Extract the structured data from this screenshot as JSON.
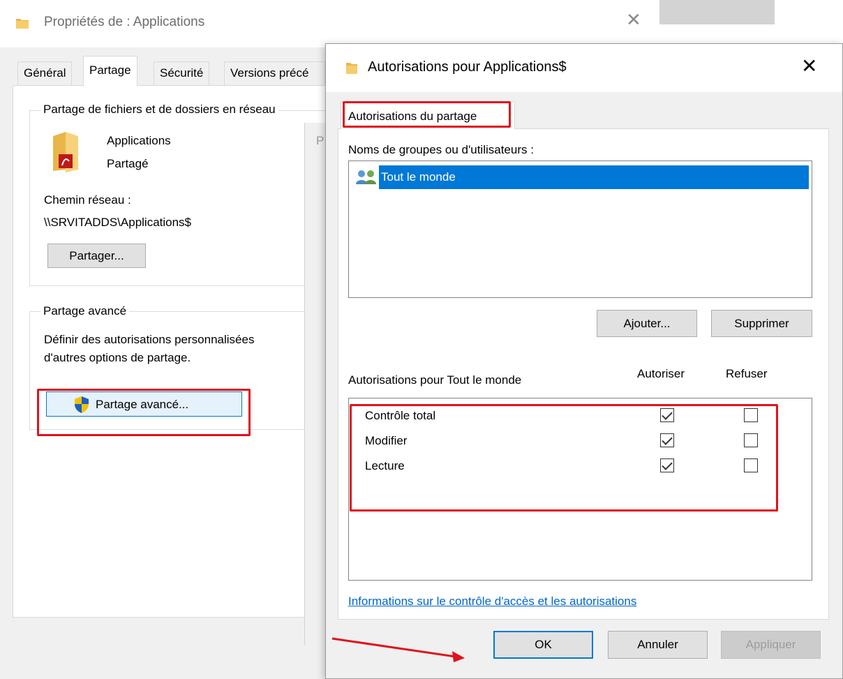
{
  "back_window": {
    "title": "Propriétés de : Applications",
    "tabs": [
      "Général",
      "Partage",
      "Sécurité",
      "Versions précé"
    ],
    "network_share": {
      "legend": "Partage de fichiers et de dossiers en réseau",
      "item_name": "Applications",
      "item_state": "Partagé",
      "path_label": "Chemin réseau :",
      "path_value": "\\\\SRVITADDS\\Applications$",
      "share_button": "Partager..."
    },
    "advanced_share": {
      "legend": "Partage avancé",
      "description_line1": "Définir des autorisations personnalisées",
      "description_line2": "d'autres options de partage.",
      "button": "Partage avancé..."
    },
    "ghost_letter": "P"
  },
  "dialog": {
    "title": "Autorisations pour Applications$",
    "tab": "Autorisations du partage",
    "groups_label": "Noms de groupes ou d'utilisateurs :",
    "groups": [
      {
        "name": "Tout le monde",
        "selected": true
      }
    ],
    "add_button": "Ajouter...",
    "remove_button": "Supprimer",
    "permissions_label": "Autorisations pour Tout le monde",
    "allow_header": "Autoriser",
    "deny_header": "Refuser",
    "permissions": [
      {
        "name": "Contrôle total",
        "allow": true,
        "deny": false
      },
      {
        "name": "Modifier",
        "allow": true,
        "deny": false
      },
      {
        "name": "Lecture",
        "allow": true,
        "deny": false
      }
    ],
    "info_link": "Informations sur le contrôle d'accès et les autorisations",
    "ok_button": "OK",
    "cancel_button": "Annuler",
    "apply_button": "Appliquer"
  },
  "colors": {
    "annotation": "#e0121b",
    "selection": "#0078d7",
    "link": "#0066cc"
  }
}
